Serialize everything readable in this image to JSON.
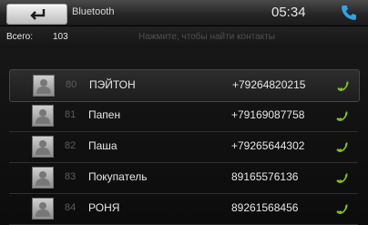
{
  "header": {
    "title": "Bluetooth",
    "time": "05:34",
    "back_icon": "back-arrow-icon",
    "phone_icon": "phone-icon"
  },
  "subbar": {
    "total_label": "Всего:",
    "total_count": "103",
    "hint": "Нажмите, чтобы найти контакты"
  },
  "contacts": [
    {
      "index": "80",
      "name": "ПЭЙТОН",
      "number": "+79264820215"
    },
    {
      "index": "81",
      "name": "Папен",
      "number": "+79169087758"
    },
    {
      "index": "82",
      "name": "Паша",
      "number": "+79265644302"
    },
    {
      "index": "83",
      "name": "Покупатель",
      "number": "89165576136"
    },
    {
      "index": "84",
      "name": "РОНЯ",
      "number": "89261568456"
    }
  ],
  "colors": {
    "call_green": "#7fbf1f",
    "header_phone_blue": "#2ea3e8"
  }
}
